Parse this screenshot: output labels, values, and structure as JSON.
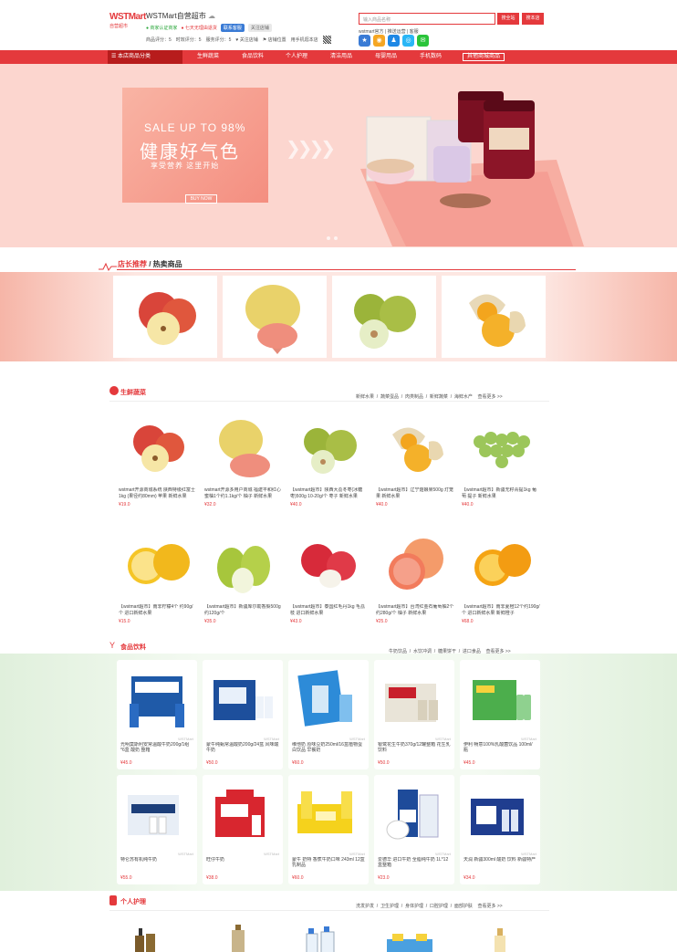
{
  "header": {
    "logo_main": "WSTMart",
    "logo_sub": "自营超市",
    "shop_name": "WSTMart自营超市",
    "badge_certified": "商家认证商家",
    "badge_return": "七天无理由退货",
    "badge_contact": "联系客服",
    "badge_follow": "关注店铺",
    "ratings": [
      "商品评分：5",
      "时效评分：5",
      "服务评分：5"
    ],
    "follow_shop": "关注店铺",
    "share": "店铺位置",
    "mobile": "用手机逛本店",
    "search_placeholder": "输入商品名称",
    "search_all": "搜全站",
    "search_shop": "搜本店",
    "hot_links": "wstmart官方 | 推送运营 | 客服"
  },
  "nav": {
    "category": "本店商品分类",
    "items": [
      "生鲜蔬菜",
      "食品饮料",
      "个人护理",
      "清洁用品",
      "母婴用品",
      "手机数码",
      "其他商城商品"
    ]
  },
  "banner": {
    "sale": "SALE UP TO 98%",
    "title": "健康好气色",
    "subtitle": "享受营养  这里开始",
    "button": "BUY NOW"
  },
  "hot": {
    "title_red": "店长推荐",
    "title_sep": " / ",
    "title_black": "热卖商品"
  },
  "floors": [
    {
      "title": "生鲜蔬菜",
      "links": [
        "新鲜水果",
        "蔬菜蛋品",
        "肉类制品",
        "新鲜蔬菜",
        "海鲜水产",
        "查看更多 >>"
      ],
      "products": [
        {
          "name": "wstmart开源商城系统 陕西特级红富士1kg (果径约80mm) 苹果 新鲜水果",
          "price": "¥19.0"
        },
        {
          "name": "wstmart开源多用户商城 福建平和红心蜜柚1个约1.1kg/个 柚子 新鲜水果",
          "price": "¥32.0"
        },
        {
          "name": "【wstmart超市】陕西大荔冬枣(冰糖枣)500g 10-20g/个 枣子 新鲜水果",
          "price": "¥40.0"
        },
        {
          "name": "【wstmart超市】辽宁菇娘果500g 灯笼果 新鲜水果",
          "price": "¥40.0"
        },
        {
          "name": "【wstmart超市】新疆无籽青提1kg 葡萄 提子 新鲜水果",
          "price": "¥40.0"
        },
        {
          "name": "【wstmart超市】南非柠檬4个 约90g/个 进口新鲜水果",
          "price": "¥15.0"
        },
        {
          "name": "【wstmart超市】新疆库尔勒香梨500g约120g/个",
          "price": "¥35.0"
        },
        {
          "name": "【wstmart超市】泰国红毛丹1kg 毛荔枝 进口新鲜水果",
          "price": "¥43.0"
        },
        {
          "name": "【wstmart超市】台湾红金石葡萄柚2个约280g/个 柚子 新鲜水果",
          "price": "¥25.0"
        },
        {
          "name": "【wstmart超市】南非夏橙12个约190g/个 进口新鲜水果 新鲜橙子",
          "price": "¥68.0"
        }
      ]
    },
    {
      "title": "食品饮料",
      "links": [
        "牛奶饮品",
        "水饮冲调",
        "糖果饼干",
        "进口食品",
        "查看更多 >>"
      ],
      "watermark": "WSTMart",
      "products": [
        {
          "name": "光明莫斯利安常温酸牛奶200g/1组*6盒 酸奶 整箱",
          "price": "¥45.0"
        },
        {
          "name": "蒙牛纯甄常温酸奶200g/24盒 风味酸牛奶",
          "price": "¥50.0"
        },
        {
          "name": "维他奶 原味豆奶250ml/16盒植物蛋白饮品 早餐奶",
          "price": "¥60.0"
        },
        {
          "name": "银鹭花生牛奶370g/12罐整箱 花生乳 饮料",
          "price": "¥50.0"
        },
        {
          "name": "伊利 畅意100%乳酸菌饮品 100ml/瓶",
          "price": "¥45.0"
        },
        {
          "name": "特仑苏有机纯牛奶",
          "price": "¥55.0"
        },
        {
          "name": "旺仔牛奶",
          "price": "¥38.0"
        },
        {
          "name": "蒙牛 奶特 香蕉牛奶口味 243ml 12盒 乳制品",
          "price": "¥60.0"
        },
        {
          "name": "爱德华 进口牛奶 全脂纯牛奶 1L*12盒整箱",
          "price": "¥23.0"
        },
        {
          "name": "天润 新疆300ml 酸奶 饮料 新疆特产",
          "price": "¥34.0"
        }
      ]
    },
    {
      "title": "个人护理",
      "links": [
        "洗发护发",
        "卫生护理",
        "身体护理",
        "口腔护理",
        "面部护肤",
        "查看更多 >>"
      ]
    }
  ],
  "colors": {
    "brand_red": "#e4393c",
    "nav_dark": "#b71c1c",
    "banner_bg": "#fcd6cf",
    "food_band": "#e0f0dc"
  }
}
